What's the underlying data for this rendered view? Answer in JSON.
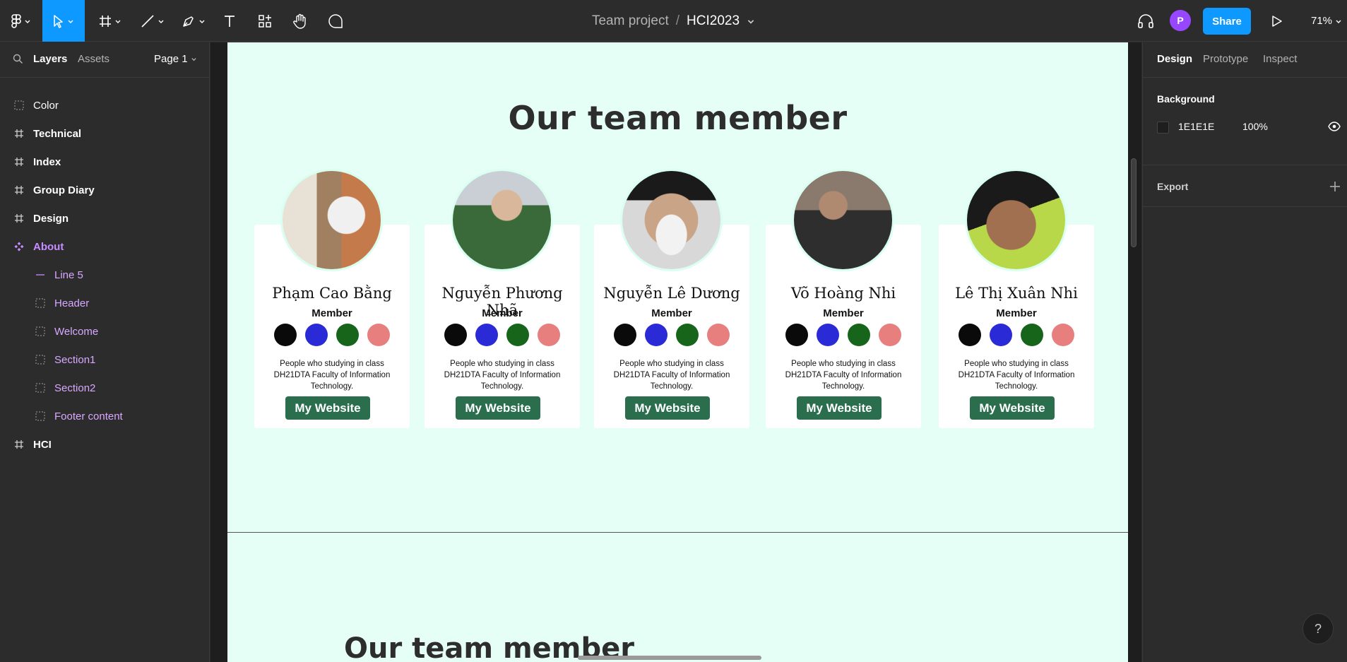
{
  "toolbar": {
    "team": "Team project",
    "separator": "/",
    "file": "HCI2023",
    "avatar_initial": "P",
    "share_label": "Share",
    "zoom": "71%"
  },
  "left_panel": {
    "tabs": {
      "layers": "Layers",
      "assets": "Assets",
      "page": "Page 1"
    },
    "layers": [
      {
        "label": "Color"
      },
      {
        "label": "Technical"
      },
      {
        "label": "Index"
      },
      {
        "label": "Group Diary"
      },
      {
        "label": "Design"
      },
      {
        "label": "About"
      },
      {
        "label": "Line 5"
      },
      {
        "label": "Header"
      },
      {
        "label": "Welcome"
      },
      {
        "label": "Section1"
      },
      {
        "label": "Section2"
      },
      {
        "label": "Footer content"
      },
      {
        "label": "HCI"
      }
    ]
  },
  "canvas": {
    "section_title": "Our team member",
    "section_title_2": "Our team member",
    "artboard_color": "#e6fff6",
    "members": [
      {
        "name": "Phạm Cao Bằng",
        "role": "Member",
        "description": "People who studying in class DH21DTA Faculty of Information Technology.",
        "button": "My Website"
      },
      {
        "name": "Nguyễn Phương Nhã",
        "role": "Member",
        "description": "People who studying in class DH21DTA Faculty of Information Technology.",
        "button": "My Website"
      },
      {
        "name": "Nguyễn Lê Dương",
        "role": "Member",
        "description": "People who studying in class DH21DTA Faculty of Information Technology.",
        "button": "My Website"
      },
      {
        "name": "Võ Hoàng Nhi",
        "role": "Member",
        "description": "People who studying in class DH21DTA Faculty of Information Technology.",
        "button": "My Website"
      },
      {
        "name": "Lê Thị Xuân Nhi",
        "role": "Member",
        "description": "People who studying in class DH21DTA Faculty of Information Technology.",
        "button": "My Website"
      }
    ],
    "dot_colors": [
      "#0a0a0a",
      "#2a2ad6",
      "#17651a",
      "#e87f7f"
    ],
    "button_color": "#2a6e4e"
  },
  "right_panel": {
    "tabs": {
      "design": "Design",
      "prototype": "Prototype",
      "inspect": "Inspect"
    },
    "background_label": "Background",
    "background_hex": "1E1E1E",
    "background_opacity": "100%",
    "export_label": "Export"
  },
  "help": "?"
}
